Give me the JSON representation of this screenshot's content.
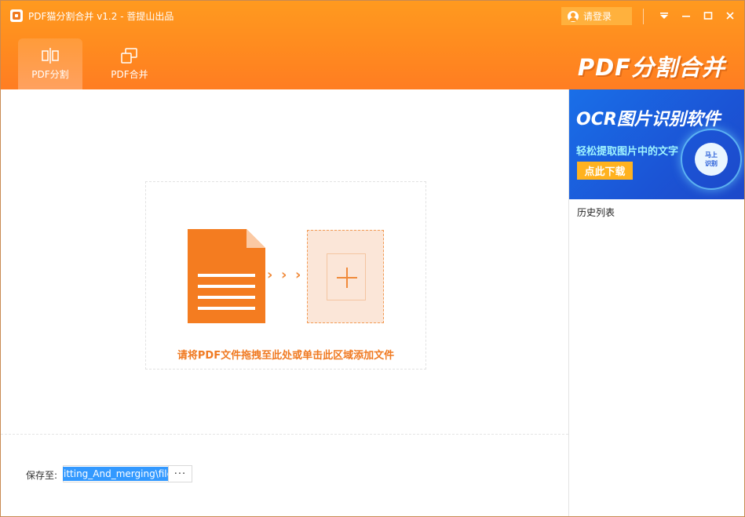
{
  "window": {
    "title": "PDF猫分割合并 v1.2 - 菩提山出品",
    "login_label": "请登录",
    "brand": "PDF分割合并"
  },
  "tabs": [
    {
      "label": "PDF分割",
      "icon": "split-icon",
      "active": true
    },
    {
      "label": "PDF合并",
      "icon": "merge-icon",
      "active": false
    }
  ],
  "dropzone": {
    "text": "请将PDF文件拖拽至此处或单击此区域添加文件",
    "arrows": "› › ›"
  },
  "save": {
    "label": "保存至:",
    "path": "itting_And_merging\\file",
    "browse_label": "···"
  },
  "ad": {
    "title": "OCR图片识别软件",
    "subtitle": "轻松提取图片中的文字",
    "button": "点此下载",
    "badge_line1": "马上",
    "badge_line2": "识别"
  },
  "history": {
    "title": "历史列表"
  },
  "colors": {
    "accent": "#ff8a1f",
    "file_orange": "#f47c20",
    "ad_blue": "#1b55d6"
  }
}
